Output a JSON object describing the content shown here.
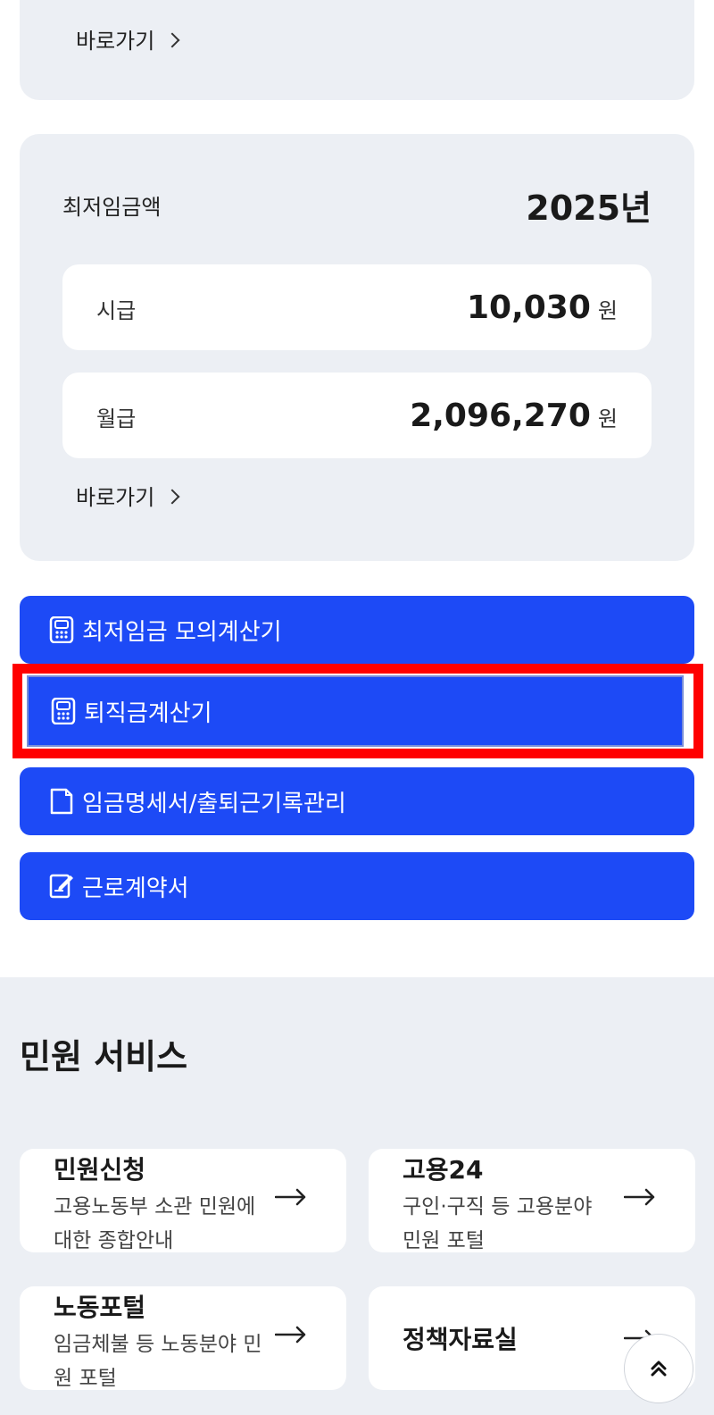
{
  "top_card": {
    "shortcut_label": "바로가기"
  },
  "wage_card": {
    "title": "최저임금액",
    "year": "2025년",
    "hourly": {
      "label": "시급",
      "value": "10,030",
      "unit": "원"
    },
    "monthly": {
      "label": "월급",
      "value": "2,096,270",
      "unit": "원"
    },
    "shortcut_label": "바로가기"
  },
  "buttons": [
    {
      "label": "최저임금 모의계산기",
      "icon": "calculator-icon"
    },
    {
      "label": "퇴직금계산기",
      "icon": "calculator-icon"
    },
    {
      "label": "임금명세서/출퇴근기록관리",
      "icon": "document-icon"
    },
    {
      "label": "근로계약서",
      "icon": "contract-edit-icon"
    }
  ],
  "section": {
    "title": "민원 서비스",
    "items": [
      {
        "title": "민원신청",
        "desc": "고용노동부 소관 민원에 대한 종합안내"
      },
      {
        "title": "고용24",
        "desc": "구인·구직 등 고용분야 민원 포털"
      },
      {
        "title": "노동포털",
        "desc": "임금체불 등 노동분야 민원 포털"
      },
      {
        "title": "정책자료실",
        "desc": ""
      }
    ]
  },
  "colors": {
    "primary_blue": "#1d4af6",
    "highlight_red": "#ff0000",
    "panel_bg": "#eceff4"
  }
}
